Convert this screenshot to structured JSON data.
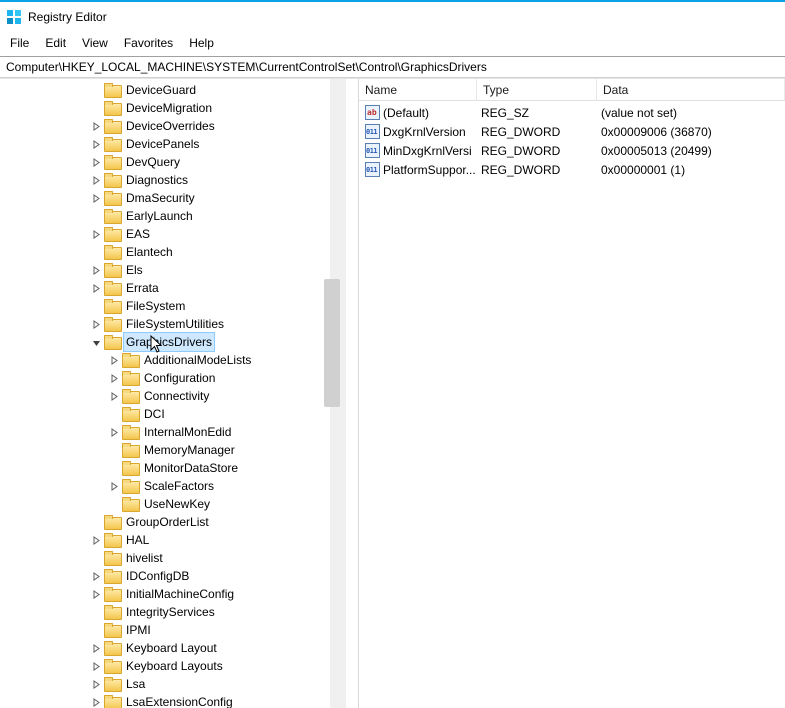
{
  "app": {
    "title": "Registry Editor"
  },
  "menu": {
    "file": "File",
    "edit": "Edit",
    "view": "View",
    "favorites": "Favorites",
    "help": "Help"
  },
  "address": "Computer\\HKEY_LOCAL_MACHINE\\SYSTEM\\CurrentControlSet\\Control\\GraphicsDrivers",
  "tree": {
    "level0": [
      {
        "label": "DeviceGuard",
        "expandable": false
      },
      {
        "label": "DeviceMigration",
        "expandable": false
      },
      {
        "label": "DeviceOverrides",
        "expandable": true
      },
      {
        "label": "DevicePanels",
        "expandable": true
      },
      {
        "label": "DevQuery",
        "expandable": true
      },
      {
        "label": "Diagnostics",
        "expandable": true
      },
      {
        "label": "DmaSecurity",
        "expandable": true
      },
      {
        "label": "EarlyLaunch",
        "expandable": false
      },
      {
        "label": "EAS",
        "expandable": true
      },
      {
        "label": "Elantech",
        "expandable": false
      },
      {
        "label": "Els",
        "expandable": true
      },
      {
        "label": "Errata",
        "expandable": true
      },
      {
        "label": "FileSystem",
        "expandable": false
      },
      {
        "label": "FileSystemUtilities",
        "expandable": true
      },
      {
        "label": "GraphicsDrivers",
        "expandable": true,
        "expanded": true,
        "selected": true
      }
    ],
    "gd_children": [
      {
        "label": "AdditionalModeLists",
        "expandable": true
      },
      {
        "label": "Configuration",
        "expandable": true
      },
      {
        "label": "Connectivity",
        "expandable": true
      },
      {
        "label": "DCI",
        "expandable": false
      },
      {
        "label": "InternalMonEdid",
        "expandable": true
      },
      {
        "label": "MemoryManager",
        "expandable": false
      },
      {
        "label": "MonitorDataStore",
        "expandable": false
      },
      {
        "label": "ScaleFactors",
        "expandable": true
      },
      {
        "label": "UseNewKey",
        "expandable": false
      }
    ],
    "level0b": [
      {
        "label": "GroupOrderList",
        "expandable": false
      },
      {
        "label": "HAL",
        "expandable": true
      },
      {
        "label": "hivelist",
        "expandable": false
      },
      {
        "label": "IDConfigDB",
        "expandable": true
      },
      {
        "label": "InitialMachineConfig",
        "expandable": true
      },
      {
        "label": "IntegrityServices",
        "expandable": false
      },
      {
        "label": "IPMI",
        "expandable": false
      },
      {
        "label": "Keyboard Layout",
        "expandable": true
      },
      {
        "label": "Keyboard Layouts",
        "expandable": true
      },
      {
        "label": "Lsa",
        "expandable": true
      },
      {
        "label": "LsaExtensionConfig",
        "expandable": true
      }
    ]
  },
  "list": {
    "headers": {
      "name": "Name",
      "type": "Type",
      "data": "Data"
    },
    "rows": [
      {
        "icon": "str",
        "name": "(Default)",
        "type": "REG_SZ",
        "data": "(value not set)"
      },
      {
        "icon": "bin",
        "name": "DxgKrnlVersion",
        "type": "REG_DWORD",
        "data": "0x00009006 (36870)"
      },
      {
        "icon": "bin",
        "name": "MinDxgKrnlVersi",
        "type": "REG_DWORD",
        "data": "0x00005013 (20499)"
      },
      {
        "icon": "bin",
        "name": "PlatformSuppor...",
        "type": "REG_DWORD",
        "data": "0x00000001 (1)"
      }
    ]
  }
}
